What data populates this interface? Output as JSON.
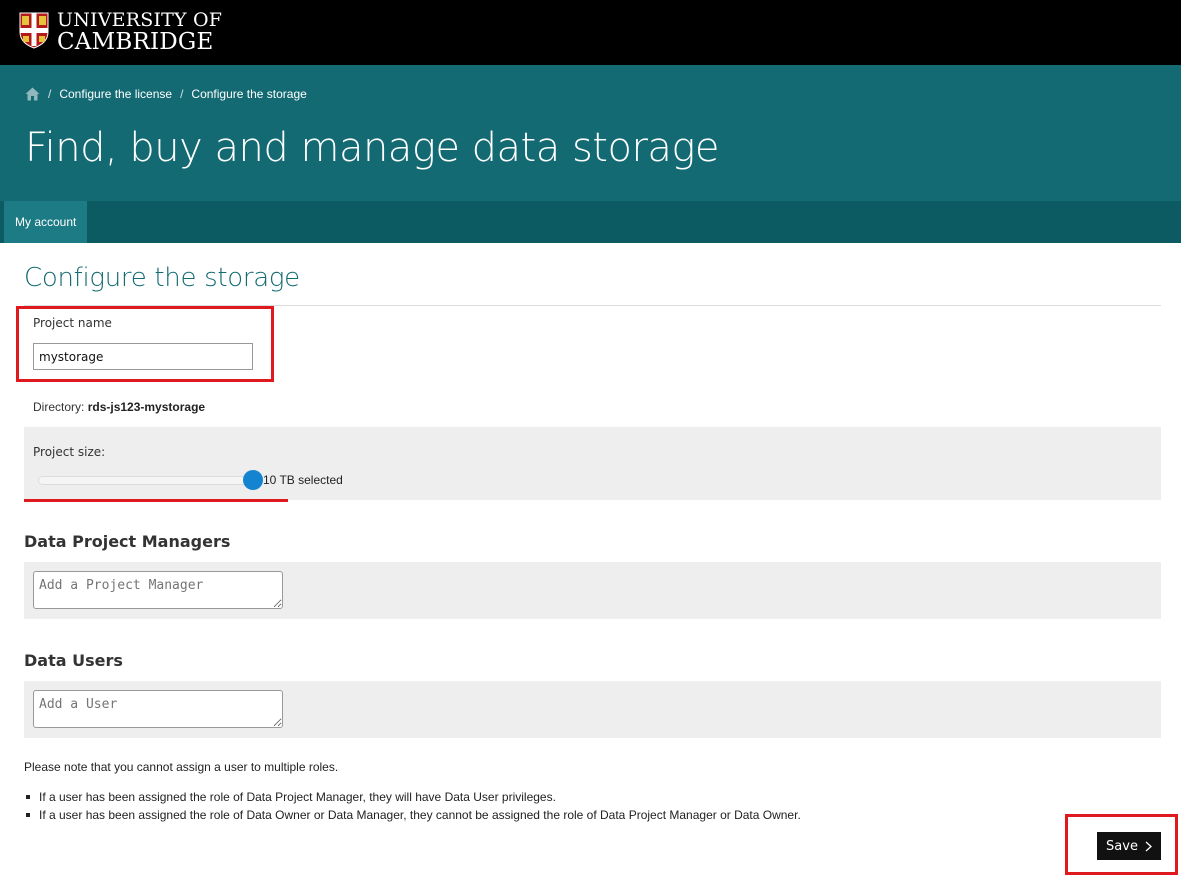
{
  "header": {
    "logo_line1": "UNIVERSITY OF",
    "logo_line2": "CAMBRIDGE",
    "crest_icon": "cambridge-crest-icon"
  },
  "breadcrumb": {
    "home_icon": "home-icon",
    "items": [
      "Configure the license",
      "Configure the storage"
    ]
  },
  "banner": {
    "title": "Find, buy and manage data storage"
  },
  "nav": {
    "items": [
      "My account"
    ]
  },
  "form": {
    "section_title": "Configure the storage",
    "project_name_label": "Project name",
    "project_name_value": "mystorage",
    "directory_label": "Directory:",
    "directory_value": "rds-js123-mystorage",
    "project_size_label": "Project size:",
    "project_size_value": "10 TB selected",
    "project_size_fraction": 1.0,
    "managers_heading": "Data Project Managers",
    "managers_placeholder": "Add a Project Manager",
    "users_heading": "Data Users",
    "users_placeholder": "Add a User",
    "note": "Please note that you cannot assign a user to multiple roles.",
    "bullets": [
      "If a user has been assigned the role of Data Project Manager, they will have Data User privileges.",
      "If a user has been assigned the role of Data Owner or Data Manager, they cannot be assigned the role of Data Project Manager or Data Owner."
    ],
    "save_label": "Save"
  },
  "colors": {
    "banner": "#136a73",
    "nav": "#0c5a62",
    "highlight": "#e0191f",
    "slider_thumb": "#1483d0"
  }
}
